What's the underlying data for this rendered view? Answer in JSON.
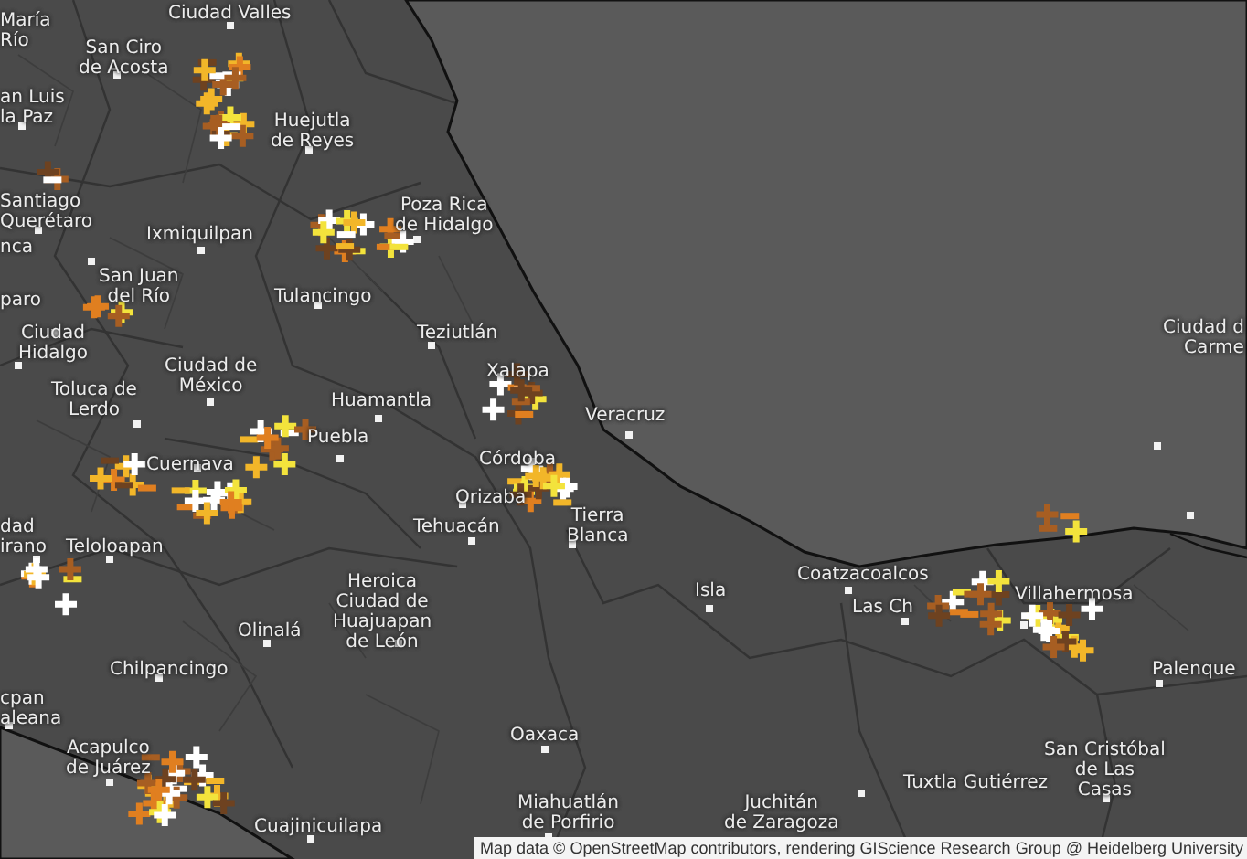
{
  "map": {
    "labels": [
      {
        "lines": [
          "Ciudad Valles"
        ]
      },
      {
        "lines": [
          "María",
          "Río"
        ]
      },
      {
        "lines": [
          "San Ciro",
          "de Acosta"
        ]
      },
      {
        "lines": [
          "an Luis",
          "la Paz"
        ]
      },
      {
        "lines": [
          "Huejutla",
          "de Reyes"
        ]
      },
      {
        "lines": [
          "Santiago",
          "Querétaro"
        ]
      },
      {
        "lines": [
          "nca"
        ]
      },
      {
        "lines": [
          "Ixmiquilpan"
        ]
      },
      {
        "lines": [
          "Poza Rica",
          "de Hidalgo"
        ]
      },
      {
        "lines": [
          "paro"
        ]
      },
      {
        "lines": [
          "San Juan",
          "del Río"
        ]
      },
      {
        "lines": [
          "Tulancingo"
        ]
      },
      {
        "lines": [
          "Ciudad",
          "Hidalgo"
        ]
      },
      {
        "lines": [
          "Teziutlán"
        ]
      },
      {
        "lines": [
          "Ciudad de",
          "México"
        ]
      },
      {
        "lines": [
          "Toluca de",
          "Lerdo"
        ]
      },
      {
        "lines": [
          "Xalapa"
        ]
      },
      {
        "lines": [
          "Huamantla"
        ]
      },
      {
        "lines": [
          "Veracruz"
        ]
      },
      {
        "lines": [
          "Puebla"
        ]
      },
      {
        "lines": [
          "Cuernava"
        ]
      },
      {
        "lines": [
          "Córdoba"
        ]
      },
      {
        "lines": [
          "Orizaba"
        ]
      },
      {
        "lines": [
          "Ciudad d",
          "Carme"
        ]
      },
      {
        "lines": [
          "Tehuacán"
        ]
      },
      {
        "lines": [
          "Tierra",
          "Blanca"
        ]
      },
      {
        "lines": [
          "dad",
          "irano"
        ]
      },
      {
        "lines": [
          "Teloloapan"
        ]
      },
      {
        "lines": [
          "Coatzacoalcos"
        ]
      },
      {
        "lines": [
          "Heroica",
          "Ciudad de",
          "Huajuapan",
          "de León"
        ]
      },
      {
        "lines": [
          "Isla"
        ]
      },
      {
        "lines": [
          "Las Ch"
        ]
      },
      {
        "lines": [
          "Villahermosa"
        ]
      },
      {
        "lines": [
          "Olinalá"
        ]
      },
      {
        "lines": [
          "Palenque"
        ]
      },
      {
        "lines": [
          "Chilpancingo"
        ]
      },
      {
        "lines": [
          "cpan",
          "aleana"
        ]
      },
      {
        "lines": [
          "Oaxaca"
        ]
      },
      {
        "lines": [
          "Acapulco",
          "de Juárez"
        ]
      },
      {
        "lines": [
          "Tuxtla Gutiérrez"
        ]
      },
      {
        "lines": [
          "San Cristóbal",
          "de Las",
          "Casas"
        ]
      },
      {
        "lines": [
          "Cuajinicuilapa"
        ]
      },
      {
        "lines": [
          "Miahuatlán",
          "de Porfirio"
        ]
      },
      {
        "lines": [
          "Juchitán",
          "de Zaragoza"
        ]
      }
    ]
  },
  "attribution": "Map data © OpenStreetMap contributors, rendering GIScience Research Group @ Heidelberg University"
}
